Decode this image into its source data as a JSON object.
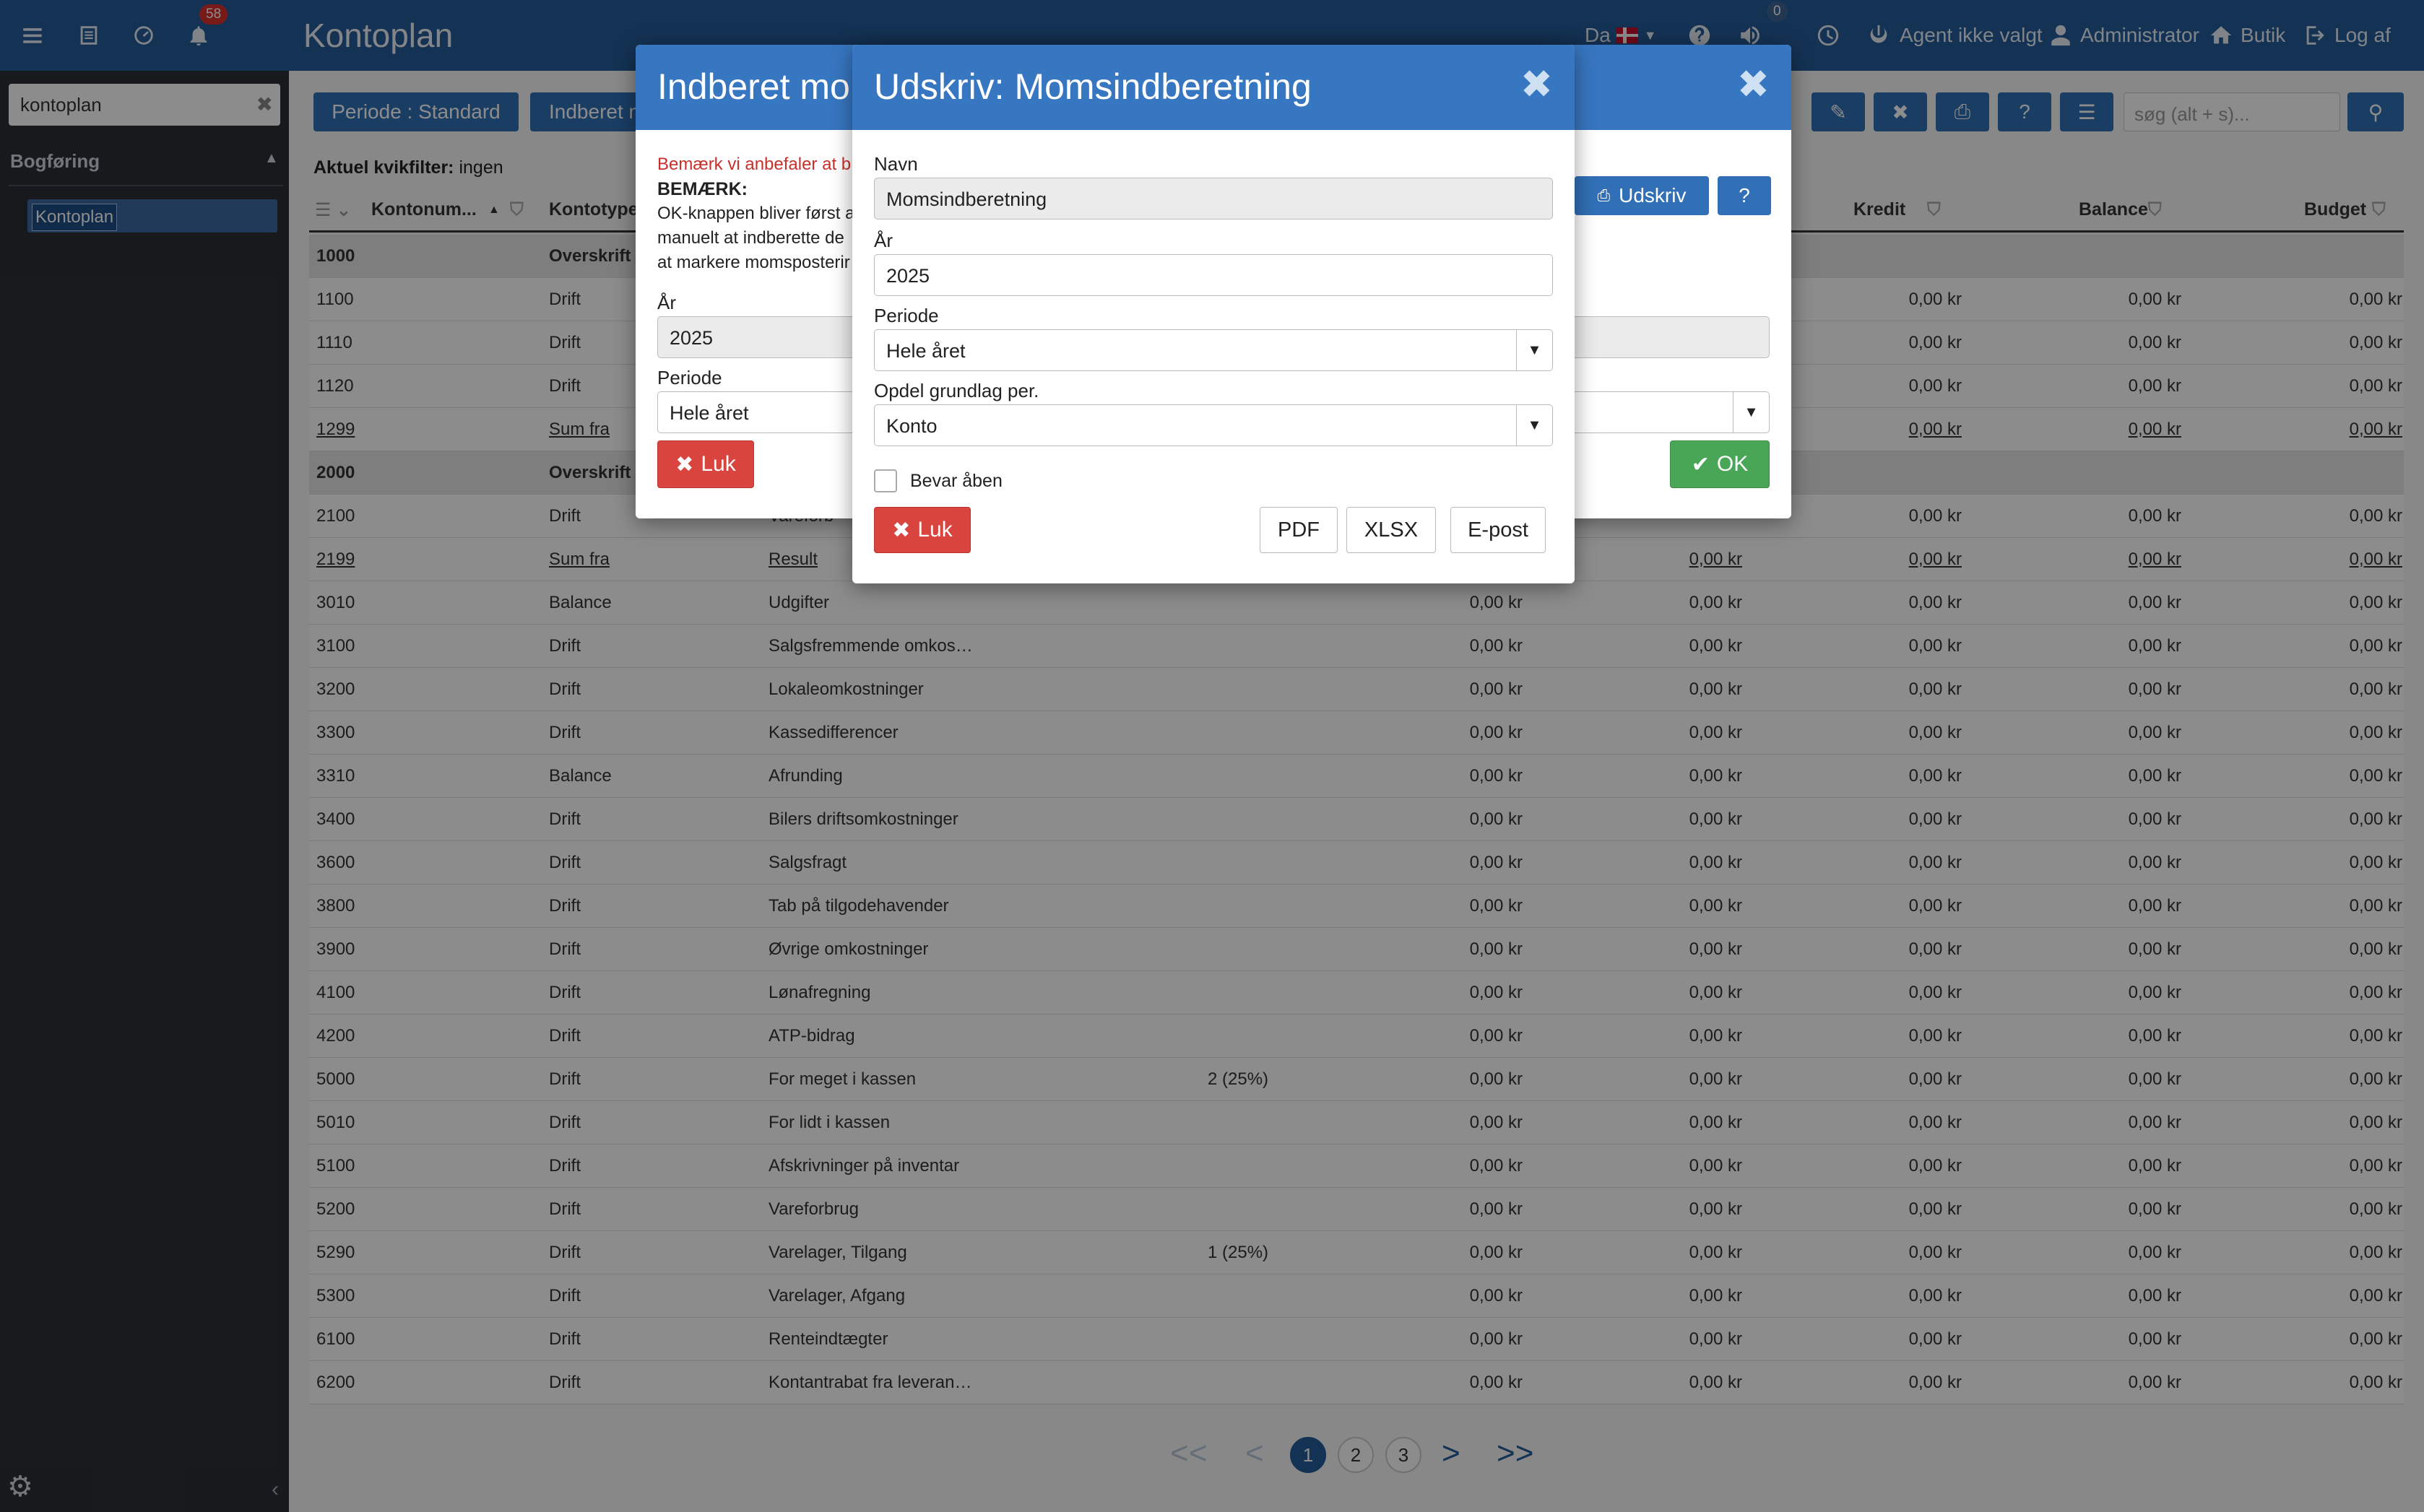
{
  "topbar": {
    "title": "Kontoplan",
    "notif_count": "58",
    "announce_count": "0",
    "language": "Da",
    "agent": "Agent ikke valgt",
    "user": "Administrator",
    "shop": "Butik",
    "logout": "Log af"
  },
  "sidebar": {
    "search_value": "kontoplan",
    "section": "Bogføring",
    "item": "Kontoplan"
  },
  "toolbar": {
    "periode": "Periode : Standard",
    "indberet": "Indberet m",
    "search_placeholder": "søg (alt + s)..."
  },
  "filter": {
    "label": "Aktuel kvikfilter:",
    "value": "ingen"
  },
  "table": {
    "columns": [
      "Kontonum...",
      "Kontotype",
      "Kredit",
      "Balance",
      "Budget"
    ],
    "rows": [
      {
        "nr": "1000",
        "type": "Overskrift",
        "name": "",
        "moms": "",
        "c1": "",
        "c2": "",
        "c3": "",
        "c4": "",
        "c5": "",
        "hdr": true
      },
      {
        "nr": "1100",
        "type": "Drift",
        "name": "",
        "moms": "",
        "c1": "",
        "c2": "",
        "c3": "0,00 kr",
        "c4": "0,00 kr",
        "c5": "0,00 kr"
      },
      {
        "nr": "1110",
        "type": "Drift",
        "name": "",
        "moms": "",
        "c1": "",
        "c2": "",
        "c3": "0,00 kr",
        "c4": "0,00 kr",
        "c5": "0,00 kr"
      },
      {
        "nr": "1120",
        "type": "Drift",
        "name": "",
        "moms": "",
        "c1": "",
        "c2": "",
        "c3": "0,00 kr",
        "c4": "0,00 kr",
        "c5": "0,00 kr"
      },
      {
        "nr": "1299",
        "type": "Sum fra",
        "name": "",
        "moms": "",
        "c1": "",
        "c2": "",
        "c3": "0,00 kr",
        "c4": "0,00 kr",
        "c5": "0,00 kr",
        "u": true
      },
      {
        "nr": "2000",
        "type": "Overskrift",
        "name": "",
        "moms": "",
        "c1": "",
        "c2": "",
        "c3": "",
        "c4": "",
        "c5": "",
        "hdr": true
      },
      {
        "nr": "2100",
        "type": "Drift",
        "name": "Vareforb",
        "moms": "",
        "c1": "",
        "c2": "",
        "c3": "0,00 kr",
        "c4": "0,00 kr",
        "c5": "0,00 kr"
      },
      {
        "nr": "2199",
        "type": "Sum fra",
        "name": "Result",
        "moms": "",
        "c1": "",
        "c2": "0,00 kr",
        "c3": "0,00 kr",
        "c4": "0,00 kr",
        "c5": "0,00 kr",
        "u": true
      },
      {
        "nr": "3010",
        "type": "Balance",
        "name": "Udgifter",
        "moms": "",
        "c1": "0,00 kr",
        "c2": "0,00 kr",
        "c3": "0,00 kr",
        "c4": "0,00 kr",
        "c5": "0,00 kr"
      },
      {
        "nr": "3100",
        "type": "Drift",
        "name": "Salgsfremmende omkos…",
        "moms": "",
        "c1": "0,00 kr",
        "c2": "0,00 kr",
        "c3": "0,00 kr",
        "c4": "0,00 kr",
        "c5": "0,00 kr"
      },
      {
        "nr": "3200",
        "type": "Drift",
        "name": "Lokaleomkostninger",
        "moms": "",
        "c1": "0,00 kr",
        "c2": "0,00 kr",
        "c3": "0,00 kr",
        "c4": "0,00 kr",
        "c5": "0,00 kr"
      },
      {
        "nr": "3300",
        "type": "Drift",
        "name": "Kassedifferencer",
        "moms": "",
        "c1": "0,00 kr",
        "c2": "0,00 kr",
        "c3": "0,00 kr",
        "c4": "0,00 kr",
        "c5": "0,00 kr"
      },
      {
        "nr": "3310",
        "type": "Balance",
        "name": "Afrunding",
        "moms": "",
        "c1": "0,00 kr",
        "c2": "0,00 kr",
        "c3": "0,00 kr",
        "c4": "0,00 kr",
        "c5": "0,00 kr"
      },
      {
        "nr": "3400",
        "type": "Drift",
        "name": "Bilers driftsomkostninger",
        "moms": "",
        "c1": "0,00 kr",
        "c2": "0,00 kr",
        "c3": "0,00 kr",
        "c4": "0,00 kr",
        "c5": "0,00 kr"
      },
      {
        "nr": "3600",
        "type": "Drift",
        "name": "Salgsfragt",
        "moms": "",
        "c1": "0,00 kr",
        "c2": "0,00 kr",
        "c3": "0,00 kr",
        "c4": "0,00 kr",
        "c5": "0,00 kr"
      },
      {
        "nr": "3800",
        "type": "Drift",
        "name": "Tab på tilgodehavender",
        "moms": "",
        "c1": "0,00 kr",
        "c2": "0,00 kr",
        "c3": "0,00 kr",
        "c4": "0,00 kr",
        "c5": "0,00 kr"
      },
      {
        "nr": "3900",
        "type": "Drift",
        "name": "Øvrige omkostninger",
        "moms": "",
        "c1": "0,00 kr",
        "c2": "0,00 kr",
        "c3": "0,00 kr",
        "c4": "0,00 kr",
        "c5": "0,00 kr"
      },
      {
        "nr": "4100",
        "type": "Drift",
        "name": "Lønafregning",
        "moms": "",
        "c1": "0,00 kr",
        "c2": "0,00 kr",
        "c3": "0,00 kr",
        "c4": "0,00 kr",
        "c5": "0,00 kr"
      },
      {
        "nr": "4200",
        "type": "Drift",
        "name": "ATP-bidrag",
        "moms": "",
        "c1": "0,00 kr",
        "c2": "0,00 kr",
        "c3": "0,00 kr",
        "c4": "0,00 kr",
        "c5": "0,00 kr"
      },
      {
        "nr": "5000",
        "type": "Drift",
        "name": "For meget i kassen",
        "moms": "2 (25%)",
        "c1": "0,00 kr",
        "c2": "0,00 kr",
        "c3": "0,00 kr",
        "c4": "0,00 kr",
        "c5": "0,00 kr"
      },
      {
        "nr": "5010",
        "type": "Drift",
        "name": "For lidt i kassen",
        "moms": "",
        "c1": "0,00 kr",
        "c2": "0,00 kr",
        "c3": "0,00 kr",
        "c4": "0,00 kr",
        "c5": "0,00 kr"
      },
      {
        "nr": "5100",
        "type": "Drift",
        "name": "Afskrivninger på inventar",
        "moms": "",
        "c1": "0,00 kr",
        "c2": "0,00 kr",
        "c3": "0,00 kr",
        "c4": "0,00 kr",
        "c5": "0,00 kr"
      },
      {
        "nr": "5200",
        "type": "Drift",
        "name": "Vareforbrug",
        "moms": "",
        "c1": "0,00 kr",
        "c2": "0,00 kr",
        "c3": "0,00 kr",
        "c4": "0,00 kr",
        "c5": "0,00 kr"
      },
      {
        "nr": "5290",
        "type": "Drift",
        "name": "Varelager, Tilgang",
        "moms": "1 (25%)",
        "c1": "0,00 kr",
        "c2": "0,00 kr",
        "c3": "0,00 kr",
        "c4": "0,00 kr",
        "c5": "0,00 kr"
      },
      {
        "nr": "5300",
        "type": "Drift",
        "name": "Varelager, Afgang",
        "moms": "",
        "c1": "0,00 kr",
        "c2": "0,00 kr",
        "c3": "0,00 kr",
        "c4": "0,00 kr",
        "c5": "0,00 kr"
      },
      {
        "nr": "6100",
        "type": "Drift",
        "name": "Renteindtægter",
        "moms": "",
        "c1": "0,00 kr",
        "c2": "0,00 kr",
        "c3": "0,00 kr",
        "c4": "0,00 kr",
        "c5": "0,00 kr"
      },
      {
        "nr": "6200",
        "type": "Drift",
        "name": "Kontantrabat fra leveran…",
        "moms": "",
        "c1": "0,00 kr",
        "c2": "0,00 kr",
        "c3": "0,00 kr",
        "c4": "0,00 kr",
        "c5": "0,00 kr"
      }
    ]
  },
  "pager": {
    "first": "<<",
    "prev": "<",
    "pages": [
      "1",
      "2",
      "3"
    ],
    "next": ">",
    "last": ">>"
  },
  "back_modal": {
    "title": "Indberet mor",
    "warning": "Bemærk vi anbefaler at b",
    "note_head": "BEMÆRK:",
    "note_1": "OK-knappen bliver først a",
    "note_2": "manuelt at indberette de",
    "note_3": "at markere momsposterir",
    "year_label": "År",
    "year_value": "2025",
    "period_label": "Periode",
    "period_value": "Hele året",
    "close": "Luk",
    "print": "Udskriv",
    "help": "?",
    "ok": "OK"
  },
  "front_modal": {
    "title": "Udskriv: Momsindberetning",
    "name_label": "Navn",
    "name_value": "Momsindberetning",
    "year_label": "År",
    "year_value": "2025",
    "period_label": "Periode",
    "period_value": "Hele året",
    "split_label": "Opdel grundlag per.",
    "split_value": "Konto",
    "keep_open": "Bevar åben",
    "close": "Luk",
    "pdf": "PDF",
    "xlsx": "XLSX",
    "email": "E-post"
  }
}
